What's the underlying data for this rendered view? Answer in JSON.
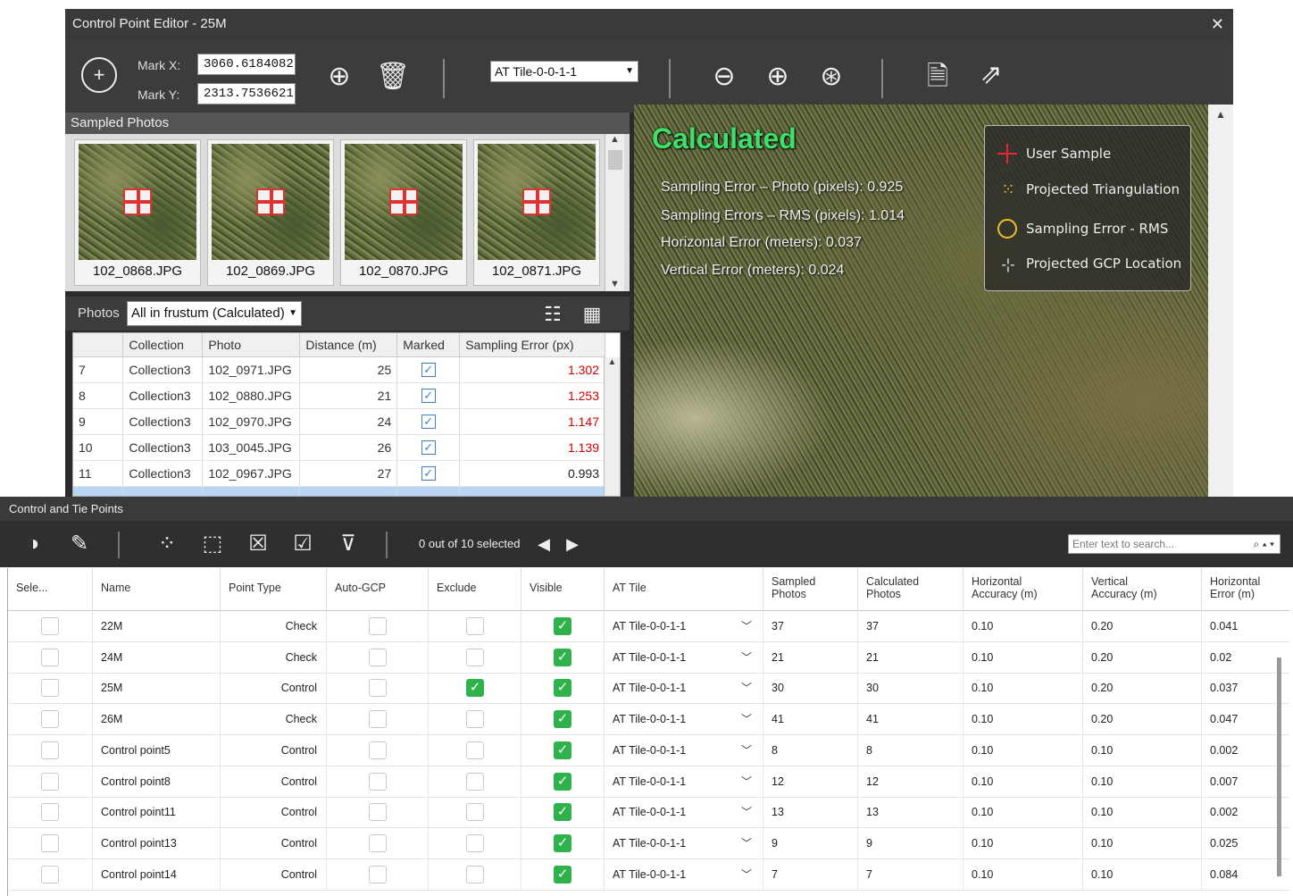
{
  "editor": {
    "title": "Control Point Editor - 25M",
    "close_icon": "close-icon",
    "mark_x_label": "Mark X:",
    "mark_y_label": "Mark Y:",
    "mark_x": "3060.6184082",
    "mark_y": "2313.7536621",
    "at_tile": "AT Tile-0-0-1-1",
    "sampled_photos_label": "Sampled Photos",
    "thumbnails": [
      "102_0868.JPG",
      "102_0869.JPG",
      "102_0870.JPG",
      "102_0871.JPG"
    ],
    "photos_label": "Photos",
    "photos_filter": "All in frustum (Calculated)",
    "table": {
      "headers": [
        "",
        "Collection",
        "Photo",
        "Distance (m)",
        "Marked",
        "Sampling Error (px)"
      ],
      "rows": [
        {
          "n": "7",
          "collection": "Collection3",
          "photo": "102_0971.JPG",
          "distance": "25",
          "error": "1.302",
          "red": true
        },
        {
          "n": "8",
          "collection": "Collection3",
          "photo": "102_0880.JPG",
          "distance": "21",
          "error": "1.253",
          "red": true
        },
        {
          "n": "9",
          "collection": "Collection3",
          "photo": "102_0970.JPG",
          "distance": "24",
          "error": "1.147",
          "red": true
        },
        {
          "n": "10",
          "collection": "Collection3",
          "photo": "103_0045.JPG",
          "distance": "26",
          "error": "1.139",
          "red": true
        },
        {
          "n": "11",
          "collection": "Collection3",
          "photo": "102_0967.JPG",
          "distance": "27",
          "error": "0.993",
          "red": false
        }
      ]
    },
    "viewer": {
      "status": "Calculated",
      "stats": [
        "Sampling Error – Photo (pixels): 0.925",
        "Sampling Errors – RMS (pixels): 1.014",
        "Horizontal Error (meters): 0.037",
        "Vertical Error (meters): 0.024"
      ],
      "legend": [
        "User Sample",
        "Projected Triangulation",
        "Sampling Error - RMS",
        "Projected GCP Location"
      ]
    }
  },
  "points": {
    "title": "Control and Tie Points",
    "selection": "0 out of 10 selected",
    "search_placeholder": "Enter text to search...",
    "headers": {
      "sel": "Sele...",
      "name": "Name",
      "type": "Point Type",
      "autogcp": "Auto-GCP",
      "exclude": "Exclude",
      "visible": "Visible",
      "attile": "AT Tile",
      "sampled": "Sampled\nPhotos",
      "calculated": "Calculated\nPhotos",
      "hacc": "Horizontal\nAccuracy (m)",
      "vacc": "Vertical\nAccuracy (m)",
      "herr": "Horizontal\nError (m)"
    },
    "rows": [
      {
        "name": "22M",
        "type": "Check",
        "exclude": false,
        "tile": "AT Tile-0-0-1-1",
        "sampled": "37",
        "calc": "37",
        "hacc": "0.10",
        "vacc": "0.20",
        "herr": "0.041"
      },
      {
        "name": "24M",
        "type": "Check",
        "exclude": false,
        "tile": "AT Tile-0-0-1-1",
        "sampled": "21",
        "calc": "21",
        "hacc": "0.10",
        "vacc": "0.20",
        "herr": "0.02"
      },
      {
        "name": "25M",
        "type": "Control",
        "exclude": true,
        "tile": "AT Tile-0-0-1-1",
        "sampled": "30",
        "calc": "30",
        "hacc": "0.10",
        "vacc": "0.20",
        "herr": "0.037"
      },
      {
        "name": "26M",
        "type": "Check",
        "exclude": false,
        "tile": "AT Tile-0-0-1-1",
        "sampled": "41",
        "calc": "41",
        "hacc": "0.10",
        "vacc": "0.20",
        "herr": "0.047"
      },
      {
        "name": "Control point5",
        "type": "Control",
        "exclude": false,
        "tile": "AT Tile-0-0-1-1",
        "sampled": "8",
        "calc": "8",
        "hacc": "0.10",
        "vacc": "0.10",
        "herr": "0.002"
      },
      {
        "name": "Control point8",
        "type": "Control",
        "exclude": false,
        "tile": "AT Tile-0-0-1-1",
        "sampled": "12",
        "calc": "12",
        "hacc": "0.10",
        "vacc": "0.10",
        "herr": "0.007"
      },
      {
        "name": "Control point11",
        "type": "Control",
        "exclude": false,
        "tile": "AT Tile-0-0-1-1",
        "sampled": "13",
        "calc": "13",
        "hacc": "0.10",
        "vacc": "0.10",
        "herr": "0.002"
      },
      {
        "name": "Control point13",
        "type": "Control",
        "exclude": false,
        "tile": "AT Tile-0-0-1-1",
        "sampled": "9",
        "calc": "9",
        "hacc": "0.10",
        "vacc": "0.10",
        "herr": "0.025"
      },
      {
        "name": "Control point14",
        "type": "Control",
        "exclude": false,
        "tile": "AT Tile-0-0-1-1",
        "sampled": "7",
        "calc": "7",
        "hacc": "0.10",
        "vacc": "0.10",
        "herr": "0.084"
      }
    ]
  },
  "colors": {
    "error_red": "#d10000",
    "visible_green": "#2fb24b",
    "calculated_green": "#3de06a"
  }
}
